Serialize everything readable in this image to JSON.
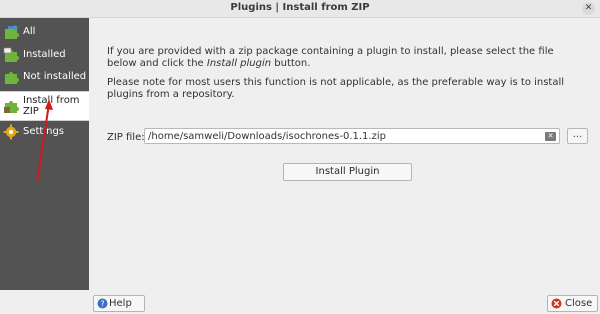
{
  "window": {
    "title": "Plugins | Install from ZIP",
    "close_glyph": "✕"
  },
  "sidebar": {
    "items": [
      {
        "label": "All",
        "icon": "puzzle-all-icon",
        "active": false
      },
      {
        "label": "Installed",
        "icon": "puzzle-installed-icon",
        "active": false
      },
      {
        "label": "Not installed",
        "icon": "puzzle-not-installed-icon",
        "active": false
      },
      {
        "label": "Install from ZIP",
        "icon": "puzzle-zip-icon",
        "active": true
      },
      {
        "label": "Settings",
        "icon": "gear-icon",
        "active": false
      }
    ]
  },
  "main": {
    "intro_part1": "If you are provided with a zip package containing a plugin to install, please select the file below and click the",
    "intro_italic": "Install plugin",
    "intro_part2": "button.",
    "note": "Please note for most users this function is not applicable, as the preferable way is to install plugins from a repository.",
    "zip_label": "ZIP file:",
    "zip_value": "/home/samweli/Downloads/isochrones-0.1.1.zip",
    "browse_label": "...",
    "install_label": "Install Plugin"
  },
  "footer": {
    "help_label": "Help",
    "close_label": "Close"
  },
  "colors": {
    "sidebar_bg": "#535353",
    "annotation_arrow": "#d01a1a"
  }
}
